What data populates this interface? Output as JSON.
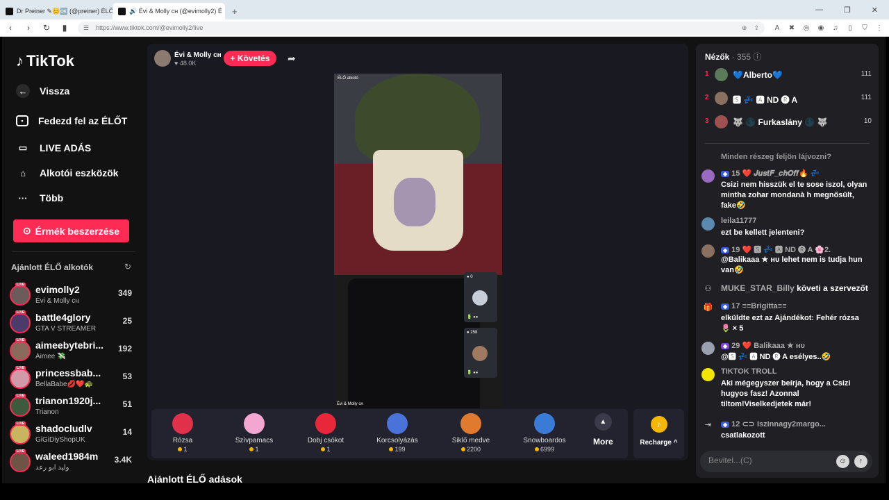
{
  "browser": {
    "tabs": [
      {
        "title": "Dr Preiner ✎😊🆗 (@preiner) ÉLŐ"
      },
      {
        "title": "🔊 Évi & Molly ᴄʜ (@evimolly2) É"
      }
    ],
    "url": "https://www.tiktok.com/@evimolly2/live"
  },
  "sidebar": {
    "logo": "TikTok",
    "back": "Vissza",
    "nav": [
      "Fedezd fel az ÉLŐT",
      "LIVE ADÁS",
      "Alkotói eszközök",
      "Több"
    ],
    "coins_button": "Érmék beszerzése",
    "recommended_title": "Ajánlott ÉLŐ alkotók",
    "creators": [
      {
        "name": "evimolly2",
        "sub": "Évi & Molly ᴄʜ",
        "count": "349"
      },
      {
        "name": "battle4glory",
        "sub": "GTA V STREAMER",
        "count": "25"
      },
      {
        "name": "aimeebytebri...",
        "sub": "Aimee 💸",
        "count": "192"
      },
      {
        "name": "princessbab...",
        "sub": "BellaBabe💋❤️🐢",
        "count": "53"
      },
      {
        "name": "trianon1920j...",
        "sub": "Trianon",
        "count": "51"
      },
      {
        "name": "shadocludlv",
        "sub": "GiGiDiyShopUK",
        "count": "14"
      },
      {
        "name": "waleed1984m",
        "sub": "وليد ابو رعد",
        "count": "3.4K"
      }
    ],
    "live_tag": "LIVE"
  },
  "stream": {
    "host_name": "Évi & Molly ᴄʜ",
    "host_likes": "♥ 48.0K",
    "follow": "+ Követés",
    "video_label_top": "ÉLŐ alkotó",
    "video_label_bottom": "Évi & Molly ᴄʜ",
    "guests": [
      {
        "count": "● 0",
        "name": "🔋 ●●"
      },
      {
        "count": "● 258",
        "name": "🔋 ●●"
      }
    ],
    "gifts": [
      {
        "name": "Rózsa",
        "price": "1",
        "color": "#e0304a"
      },
      {
        "name": "Szívpamacs",
        "price": "1",
        "color": "#f2a6d0"
      },
      {
        "name": "Dobj csókot",
        "price": "1",
        "color": "#e8283a"
      },
      {
        "name": "Korcsolyázás",
        "price": "199",
        "color": "#4a73d9"
      },
      {
        "name": "Siklő medve",
        "price": "2200",
        "color": "#e07a2e"
      },
      {
        "name": "Snowboardos",
        "price": "6999",
        "color": "#3b7bd8"
      }
    ],
    "more": "More",
    "recharge": "Recharge ^"
  },
  "recommended_live_title": "Ajánlott ÉLŐ adások",
  "chat": {
    "viewers_label": "Nézők",
    "viewers_count": "· 355",
    "ranking": [
      {
        "rank": "1",
        "name": "💙Alberto💙",
        "score": "111"
      },
      {
        "rank": "2",
        "name": "🆂 💤 🅰 ND 🅡 A",
        "score": "111"
      },
      {
        "rank": "3",
        "name": "🐺 🌑 Furkaslány 🌑 🐺",
        "score": "10"
      }
    ],
    "messages": [
      {
        "user": "",
        "text": "Minden részeg feljön lájvozni?"
      },
      {
        "user": "15 ❤️ 𝑱𝒖𝒔𝒕𝑭_𝒄𝒉𝑶𝒇𝒇🔥 💤",
        "text": "Csizi nem hisszük el te sose iszol, olyan mintha zohar mondanà h megnősült, fake🤣"
      },
      {
        "user": "leila11777",
        "text": "ezt be kellett jelenteni?"
      },
      {
        "user": "19 ❤️ 🆂 💤 🅰 ND 🅡 A 🌸2.",
        "text": "@Balikaaa ★ ʜᴜ lehet nem is tudja hun van🤣"
      },
      {
        "user": "MUKE_STAR_Billy",
        "text": "követi a szervezőt"
      },
      {
        "user": "17 ≡≡Brigitta≡≡",
        "text": "elküldte ezt az Ajándékot: Fehér rózsa 🌷 × 5"
      },
      {
        "user": "29 ❤️ Balikaaa ★ ʜᴜ",
        "text": "@🆂 💤 🅰 ND 🅡 A esélyes..🤣"
      },
      {
        "user": "TIKTOK TROLL",
        "text": "Aki mégegyszer beírja, hogy a Csizi hugyos fasz! Azonnal tiltom!Viselkedjetek már!"
      },
      {
        "user": "12 ⊂⊃ Iszinnagy2margo...",
        "text": "csatlakozott"
      }
    ],
    "input_placeholder": "Bevitel...(C)"
  }
}
